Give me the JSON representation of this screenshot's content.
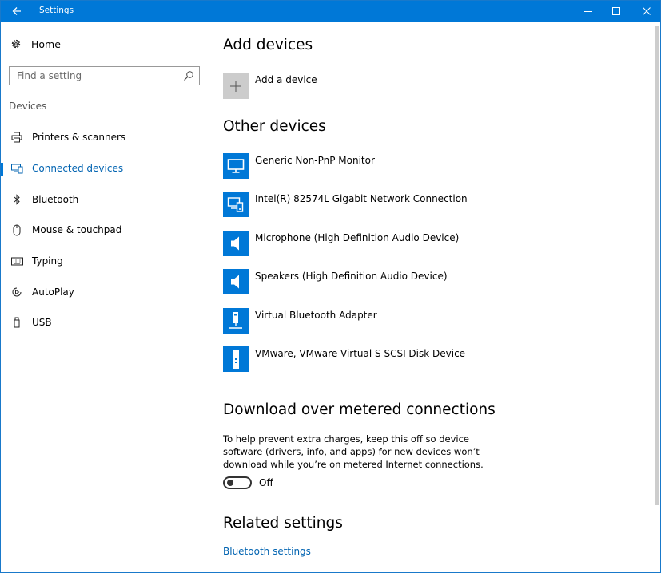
{
  "window": {
    "title": "Settings"
  },
  "sidebar": {
    "home_label": "Home",
    "search": {
      "placeholder": "Find a setting"
    },
    "section_label": "Devices",
    "items": [
      {
        "label": "Printers & scanners",
        "icon": "printer-icon",
        "active": false
      },
      {
        "label": "Connected devices",
        "icon": "connected-devices-icon",
        "active": true
      },
      {
        "label": "Bluetooth",
        "icon": "bluetooth-icon",
        "active": false
      },
      {
        "label": "Mouse & touchpad",
        "icon": "mouse-icon",
        "active": false
      },
      {
        "label": "Typing",
        "icon": "keyboard-icon",
        "active": false
      },
      {
        "label": "AutoPlay",
        "icon": "autoplay-icon",
        "active": false
      },
      {
        "label": "USB",
        "icon": "usb-icon",
        "active": false
      }
    ]
  },
  "main": {
    "add_devices": {
      "heading": "Add devices",
      "add_label": "Add a device"
    },
    "other_devices": {
      "heading": "Other devices",
      "items": [
        {
          "name": "Generic Non-PnP Monitor",
          "icon": "monitor-icon"
        },
        {
          "name": "Intel(R) 82574L Gigabit Network Connection",
          "icon": "network-icon"
        },
        {
          "name": "Microphone (High Definition Audio Device)",
          "icon": "speaker-icon"
        },
        {
          "name": "Speakers (High Definition Audio Device)",
          "icon": "speaker-icon"
        },
        {
          "name": "Virtual Bluetooth Adapter",
          "icon": "adapter-icon"
        },
        {
          "name": "VMware, VMware Virtual S SCSI Disk Device",
          "icon": "disk-icon"
        }
      ]
    },
    "metered": {
      "heading": "Download over metered connections",
      "description": "To help prevent extra charges, keep this off so device software (drivers, info, and apps) for new devices won’t download while you’re on metered Internet connections.",
      "toggle_state": "Off"
    },
    "related": {
      "heading": "Related settings",
      "link": "Bluetooth settings"
    }
  },
  "colors": {
    "accent": "#0078d7",
    "link": "#0063b1",
    "tile_gray": "#cccccc"
  }
}
